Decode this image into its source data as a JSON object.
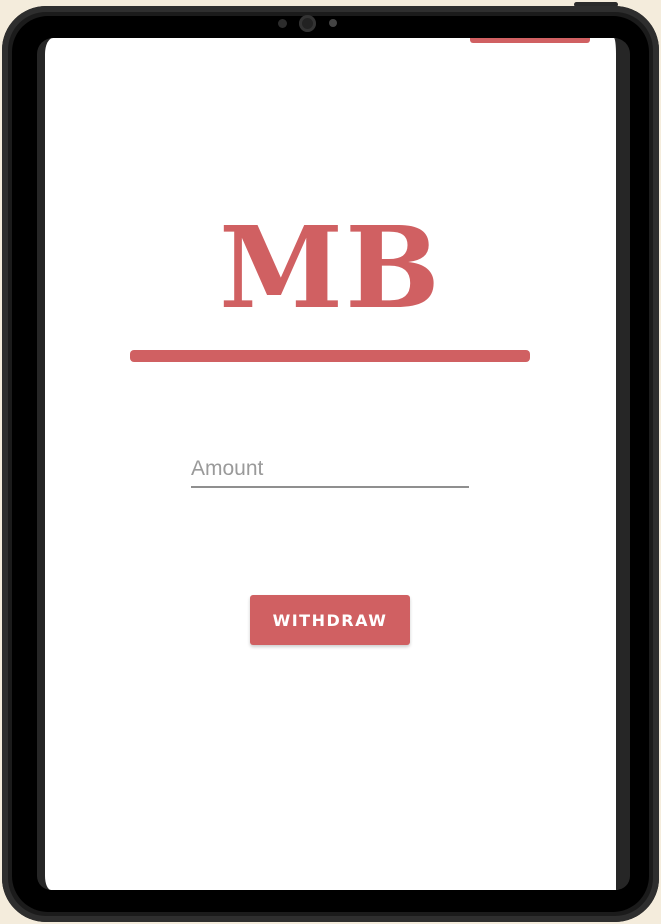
{
  "app": {
    "logo_text": "MB"
  },
  "form": {
    "amount_placeholder": "Amount",
    "amount_value": "",
    "withdraw_label": "WITHDRAW"
  },
  "colors": {
    "accent": "#d06062",
    "background": "#f4ecdc",
    "device_frame": "#1b1b1b",
    "screen": "#ffffff"
  },
  "icons": [
    "front-camera-icon",
    "sensor-icon"
  ]
}
